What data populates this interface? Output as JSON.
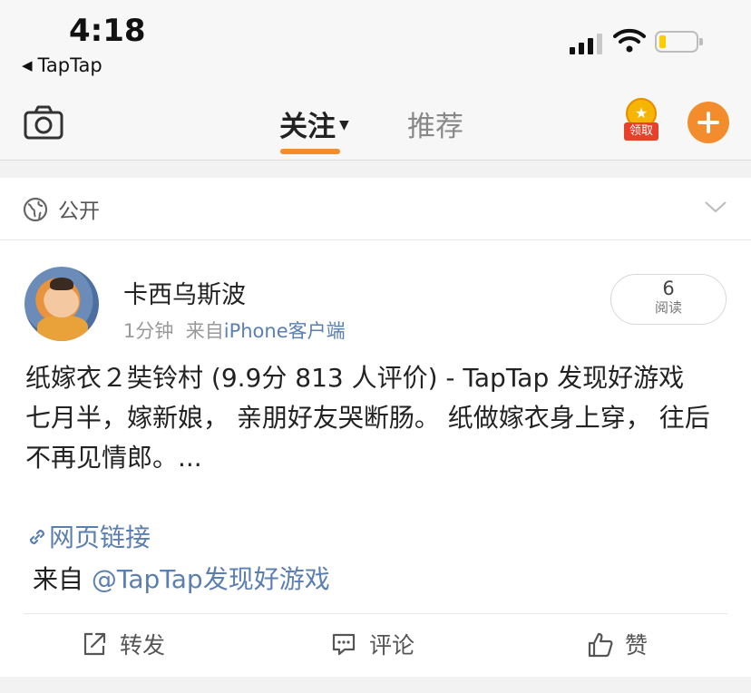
{
  "status_bar": {
    "time": "4:18",
    "back_app": "TapTap",
    "battery_level": 0.15
  },
  "nav": {
    "tabs": [
      {
        "label": "关注",
        "active": true
      },
      {
        "label": "推荐",
        "active": false
      }
    ],
    "reward_label": "领取",
    "accent_color": "#f28c2c"
  },
  "visibility": {
    "label": "公开"
  },
  "post": {
    "username": "卡西乌斯波",
    "time_ago": "1分钟",
    "from_prefix": "来自",
    "client": "iPhone客户端",
    "read_count": "6",
    "read_label": "阅读",
    "content_lines": [
      "纸嫁衣２奘铃村 (9.9分 813 人评价) - TapTap 发现好游戏",
      "七月半，嫁新娘， 亲朋好友哭断肠。 纸做嫁衣身上穿， 往后不再见情郎。..."
    ],
    "link_icon": "link-icon",
    "link_text": "网页链接",
    "source_prefix": "来自 ",
    "source_link": "@TapTap发现好游戏"
  },
  "actions": {
    "repost": "转发",
    "comment": "评论",
    "like": "赞"
  }
}
